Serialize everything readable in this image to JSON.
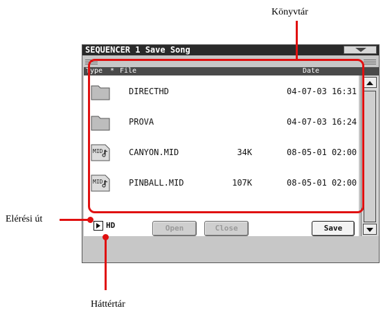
{
  "annotations": {
    "library": "Könyvtár",
    "path": "Elérési út",
    "storage": "Háttértár"
  },
  "window": {
    "title": "SEQUENCER 1  Save Song"
  },
  "columns": {
    "type": "Type",
    "sort": "*",
    "file": "File",
    "date": "Date"
  },
  "files": [
    {
      "icon": "folder-icon",
      "name": "DIRECTHD",
      "size": "",
      "date": "04-07-03 16:31"
    },
    {
      "icon": "folder-icon",
      "name": "PROVA",
      "size": "",
      "date": "04-07-03 16:24"
    },
    {
      "icon": "midi-file-icon",
      "name": "CANYON.MID",
      "size": "34K",
      "date": "08-05-01 02:00"
    },
    {
      "icon": "midi-file-icon",
      "name": "PINBALL.MID",
      "size": "107K",
      "date": "08-05-01 02:00"
    }
  ],
  "icon_label": "MID",
  "path": {
    "current": "HD"
  },
  "buttons": {
    "open": "Open",
    "close": "Close",
    "save": "Save"
  },
  "colors": {
    "annotation_red": "#e01010",
    "title_bar": "#2a2a2a",
    "panel": "#c7c7c7"
  }
}
